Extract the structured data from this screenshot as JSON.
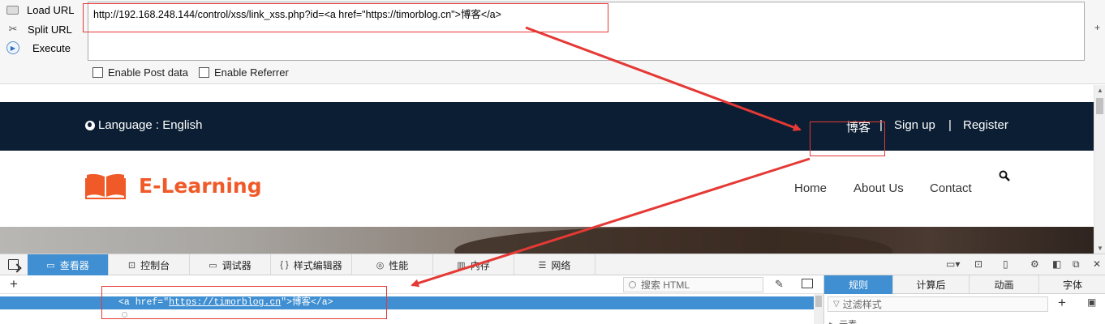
{
  "hackbar": {
    "buttons": {
      "load_url": "Load URL",
      "split_url": "Split URL",
      "execute": "Execute"
    },
    "url_value": "http://192.168.248.144/control/xss/link_xss.php?id=<a href=\"https://timorblog.cn\">博客</a>",
    "options": {
      "post": "Enable Post data",
      "referrer": "Enable Referrer"
    },
    "icons": [
      "load-icon",
      "scissors-icon",
      "play-icon",
      "plus-icon"
    ]
  },
  "site": {
    "language": "Language : English",
    "top_links": {
      "blog": "博客",
      "separator": "|",
      "signup": "Sign up",
      "register": "Register"
    },
    "logo_text": "E-Learning",
    "menu": {
      "home": "Home",
      "about": "About Us",
      "contact": "Contact"
    },
    "colors": {
      "topbar": "#0b1e33",
      "brand": "#f05a28"
    }
  },
  "devtools": {
    "tabs": [
      "查看器",
      "控制台",
      "调试器",
      "样式编辑器",
      "性能",
      "内存",
      "网络"
    ],
    "tab_icons": [
      "▭",
      "⊡",
      "▭",
      "{ }",
      "◎",
      "▥",
      "☰"
    ],
    "active_tab": "查看器",
    "add_node": "+",
    "search_placeholder": "搜索 HTML",
    "node": {
      "open": "<a href=\"",
      "href": "https://timorblog.cn",
      "close": "\">博客</a>"
    },
    "side_tabs": [
      "规则",
      "计算后",
      "动画",
      "字体"
    ],
    "active_side_tab": "规则",
    "filter_placeholder": "过滤样式",
    "add_rule": "+",
    "element_label": "元素",
    "accent": "#3f8fd2"
  },
  "annotation_color": "#e53935"
}
